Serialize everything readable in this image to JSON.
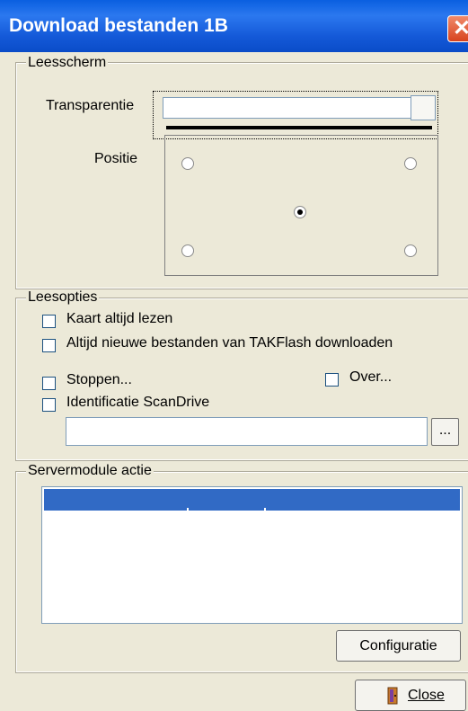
{
  "window": {
    "title": "Download bestanden 1B"
  },
  "leesscherm": {
    "legend": "Leesscherm",
    "transparency_label": "Transparentie",
    "transparency_level_percent": 95,
    "position_label": "Positie",
    "position_options": [
      "top-left",
      "top-right",
      "center",
      "bottom-left",
      "bottom-right"
    ],
    "selected_position": "center"
  },
  "leesopties": {
    "legend": "Leesopties",
    "always_read_card": "Kaart altijd lezen",
    "always_download_new": "Altijd nieuwe bestanden van TAKFlash downloaden",
    "stop": "Stoppen...",
    "about": "Over...",
    "identification": "Identificatie ScanDrive",
    "path_value": "",
    "browse_label": "..."
  },
  "servermodule": {
    "legend": "Servermodule actie",
    "rows": [],
    "config_button": "Configuratie"
  },
  "footer": {
    "close_label": "Close"
  },
  "colors": {
    "titlebar": "#1459d8",
    "selection": "#316ac5",
    "background": "#ece9d8"
  }
}
